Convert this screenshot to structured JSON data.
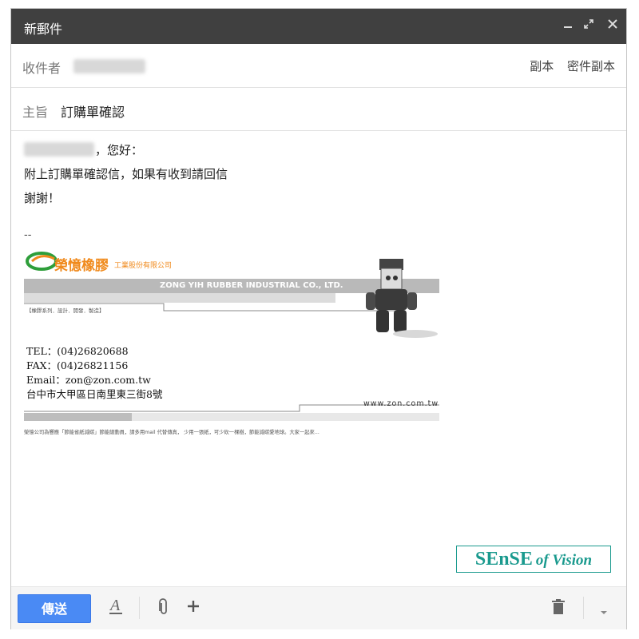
{
  "window": {
    "title": "新郵件",
    "minimize_icon": "minimize-icon",
    "popout_icon": "expand-icon",
    "close_icon": "close-icon"
  },
  "to": {
    "label": "收件者",
    "cc_label": "副本",
    "bcc_label": "密件副本"
  },
  "subject": {
    "label": "主旨",
    "value": "訂購單確認"
  },
  "body": {
    "greeting": "，您好：",
    "line2": "附上訂購單確認信，如果有收到請回信",
    "line3": "謝謝！",
    "sig_sep": "--"
  },
  "signature": {
    "company_cn": "榮憶橡膠",
    "company_cn_suffix": "工業股份有限公司",
    "company_en": "ZONG YIH RUBBER INDUSTRIAL CO., LTD.",
    "tagline": "【橡膠系列．設計．開發．製造】",
    "tel": "TEL：(04)26820688",
    "fax": "FAX：(04)26821156",
    "email": "Email：zon@zon.com.tw",
    "address": "台中市大甲區日南里東三街8號",
    "website": "www.zon.com.tw",
    "footer": "榮憶公司為響應「節能省紙減碳」節能總動員，請多用mail 代替傳真， 少用一張紙，可少砍一棵樹，節能減碳愛地球。大家一起來..."
  },
  "watermark": {
    "big": "SEnSE",
    "small": "of Vision"
  },
  "toolbar": {
    "send_label": "傳送",
    "format_icon": "text-format-icon",
    "attach_icon": "paperclip-icon",
    "more_icon": "plus-icon",
    "trash_icon": "trash-icon",
    "options_icon": "chevron-down-icon"
  },
  "colors": {
    "titlebar": "#404040",
    "send": "#4a8af4",
    "accent": "#1a9a8e"
  }
}
